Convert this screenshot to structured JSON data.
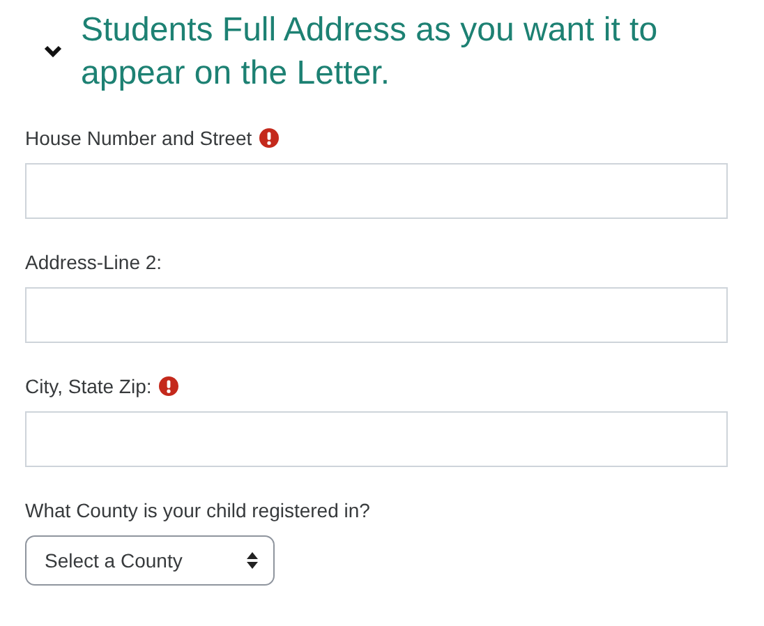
{
  "section": {
    "title": "Students Full Address as you want it to appear on the Letter.",
    "expanded": true
  },
  "fields": [
    {
      "kind": "text",
      "label": "House Number and Street",
      "required": true
    },
    {
      "kind": "text",
      "label": "Address-Line 2:",
      "required": false
    },
    {
      "kind": "text",
      "label": "City, State Zip:",
      "required": true
    },
    {
      "kind": "select",
      "label": "What County is your child registered in?",
      "required": false,
      "value": "Select a County"
    }
  ]
}
